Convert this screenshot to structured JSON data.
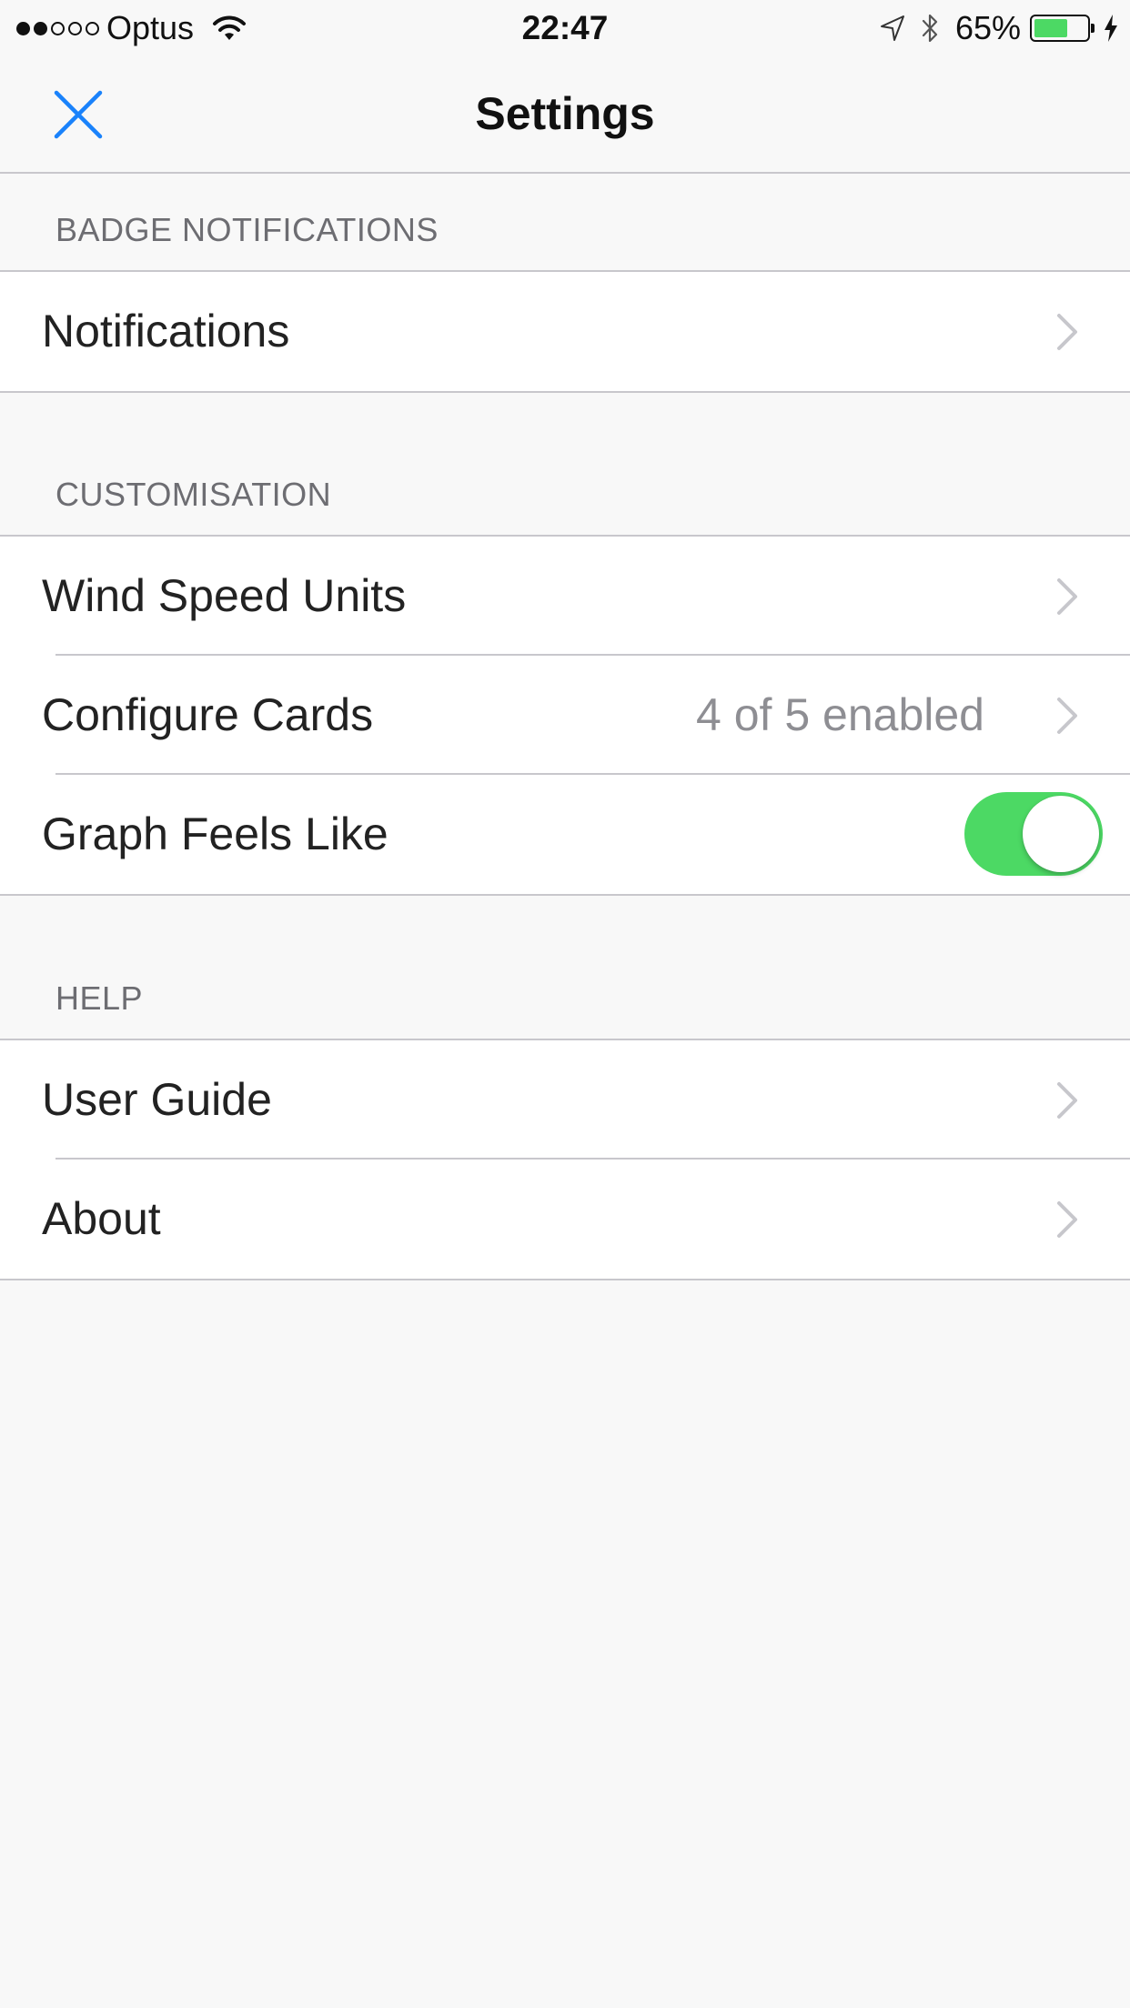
{
  "status_bar": {
    "carrier": "Optus",
    "time": "22:47",
    "battery_percent": "65%",
    "battery_level": 0.65,
    "signal_bars_filled": 2,
    "signal_bars_total": 5,
    "charging": true,
    "icons": [
      "signal-dots-icon",
      "wifi-icon",
      "location-arrow-icon",
      "bluetooth-icon",
      "battery-icon",
      "charging-bolt-icon"
    ]
  },
  "nav": {
    "title": "Settings",
    "close_icon": "close-icon"
  },
  "sections": [
    {
      "header": "BADGE NOTIFICATIONS",
      "rows": [
        {
          "label": "Notifications",
          "accessory": "chevron"
        }
      ]
    },
    {
      "header": "CUSTOMISATION",
      "rows": [
        {
          "label": "Wind Speed Units",
          "accessory": "chevron"
        },
        {
          "label": "Configure Cards",
          "detail": "4 of 5 enabled",
          "accessory": "chevron"
        },
        {
          "label": "Graph Feels Like",
          "accessory": "toggle",
          "toggle_on": true
        }
      ]
    },
    {
      "header": "HELP",
      "rows": [
        {
          "label": "User Guide",
          "accessory": "chevron"
        },
        {
          "label": "About",
          "accessory": "chevron"
        }
      ]
    }
  ],
  "colors": {
    "accent": "#1a82fb",
    "toggle_on": "#4cd964",
    "battery_fill": "#4cd964",
    "background": "#f8f8f8",
    "section_header": "#6d6d72",
    "detail_text": "#8e8e93",
    "separator": "#c8c7cc"
  }
}
